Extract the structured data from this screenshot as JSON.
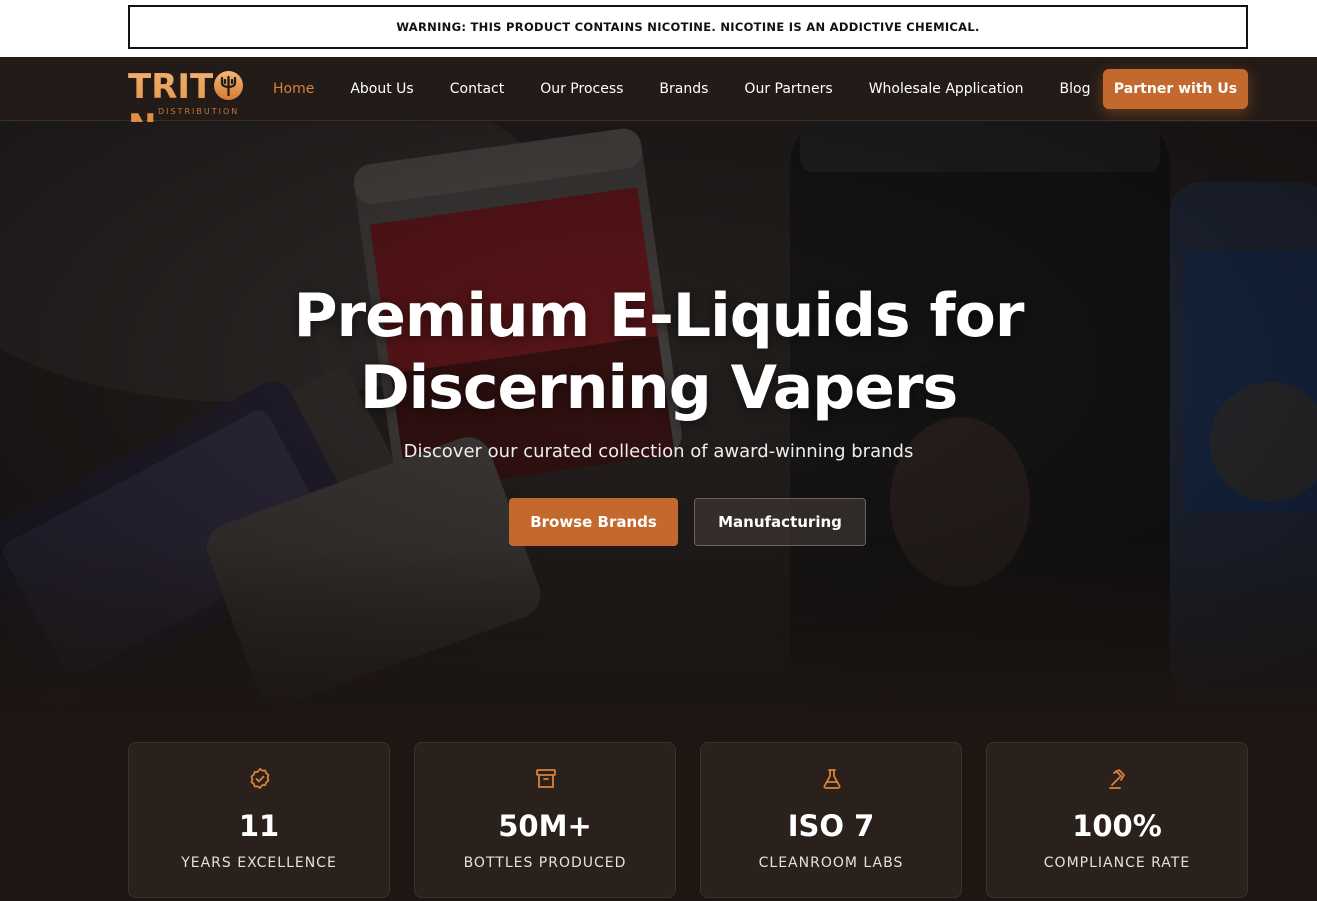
{
  "warning_banner": "WARNING: THIS PRODUCT CONTAINS NICOTINE. NICOTINE IS AN ADDICTIVE CHEMICAL.",
  "brand": {
    "name_part1": "TRIT",
    "name_part2": "N",
    "subtitle": "DISTRIBUTION"
  },
  "nav": {
    "items": [
      {
        "label": "Home",
        "active": true
      },
      {
        "label": "About Us"
      },
      {
        "label": "Contact"
      },
      {
        "label": "Our Process"
      },
      {
        "label": "Brands"
      },
      {
        "label": "Our Partners"
      },
      {
        "label": "Wholesale Application"
      },
      {
        "label": "Blog"
      }
    ],
    "cta_label": "Partner with Us"
  },
  "hero": {
    "title": "Premium E-Liquids for\nDiscerning Vapers",
    "subtitle": "Discover our curated collection of award-winning brands",
    "primary_button": "Browse Brands",
    "secondary_button": "Manufacturing"
  },
  "stats": [
    {
      "icon": "badge-check-icon",
      "value": "11",
      "label": "YEARS EXCELLENCE"
    },
    {
      "icon": "archive-box-icon",
      "value": "50M+",
      "label": "BOTTLES PRODUCED"
    },
    {
      "icon": "flask-icon",
      "value": "ISO 7",
      "label": "CLEANROOM LABS"
    },
    {
      "icon": "gavel-icon",
      "value": "100%",
      "label": "COMPLIANCE RATE"
    }
  ],
  "colors": {
    "accent": "#c4692d",
    "nav_active": "#d9823b",
    "background": "#1d1613",
    "card": "#2a211d"
  }
}
